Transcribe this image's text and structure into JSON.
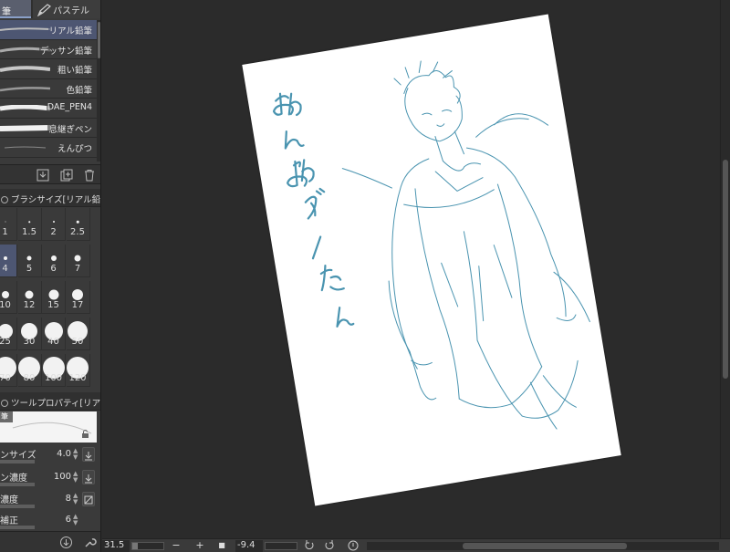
{
  "left_panel": {
    "tabs": [
      {
        "label": "筆"
      },
      {
        "label": "パステル",
        "icon": "pastel-pen-icon"
      }
    ],
    "brushes": [
      {
        "name": "リアル鉛筆",
        "selected": true
      },
      {
        "name": "デッサン鉛筆",
        "selected": false
      },
      {
        "name": "粗い鉛筆",
        "selected": false
      },
      {
        "name": "色鉛筆",
        "selected": false
      },
      {
        "name": "DAE_PEN4",
        "selected": false
      },
      {
        "name": "息継ぎペン",
        "selected": false
      },
      {
        "name": "えんぴつ",
        "selected": false
      }
    ],
    "brush_tools": [
      "download-icon",
      "duplicate-icon",
      "trash-icon"
    ],
    "brush_size_header": "ブラシサイズ[リアル鉛筆",
    "brush_sizes": [
      "1",
      "1.5",
      "2",
      "2.5",
      "4",
      "5",
      "6",
      "7",
      "10",
      "12",
      "15",
      "17",
      "25",
      "30",
      "40",
      "50",
      "70",
      "80",
      "100",
      "120"
    ],
    "selected_brush_size": "4",
    "tool_property_header": "ツールプロパティ[リアル",
    "preview_tag": "筆",
    "properties": [
      {
        "name": "ンサイズ",
        "value": "4.0",
        "button": "pressure-icon"
      },
      {
        "name": "ン濃度",
        "value": "100",
        "button": "pressure-icon"
      },
      {
        "name": "濃度",
        "value": "8",
        "button": "slash-box-icon"
      },
      {
        "name": "補正",
        "value": "6",
        "button": ""
      }
    ],
    "bottom_icons": [
      "download-circle-icon",
      "wrench-icon"
    ]
  },
  "status_bar": {
    "zoom": "31.5",
    "zoom_out": "−",
    "zoom_in": "+",
    "fit": "■",
    "angle": "-9.4",
    "icons": [
      "rotate-left-icon",
      "rotate-right-icon",
      "reset-rotation-icon"
    ]
  },
  "canvas": {
    "handwriting": "おんおダノたん",
    "ink_color": "#4a94b0",
    "paper_color": "#ffffff",
    "background_color": "#2b2b2b"
  },
  "colors": {
    "selection": "#4d5672",
    "panel": "#3a3a3a"
  }
}
